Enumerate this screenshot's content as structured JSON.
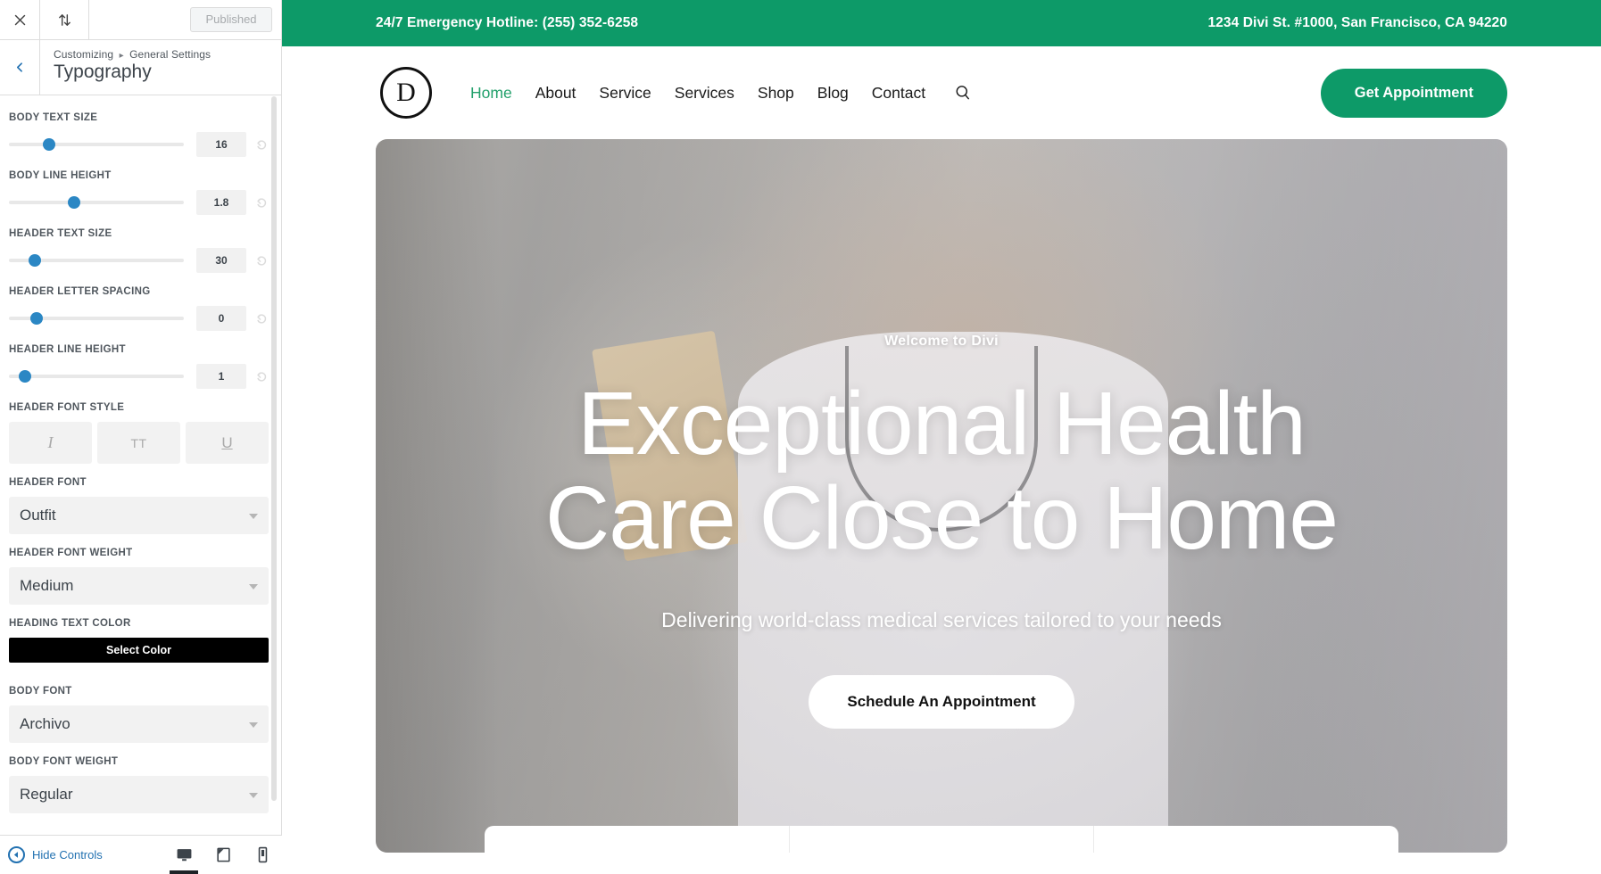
{
  "customizer": {
    "topbar": {
      "close_label": "Close customizer",
      "devices_label": "Collapse / expand",
      "publish_label": "Published"
    },
    "breadcrumb_root": "Customizing",
    "breadcrumb_separator": "▸",
    "breadcrumb_section": "General Settings",
    "panel_title": "Typography",
    "sliders": [
      {
        "label": "BODY TEXT SIZE",
        "value": "16",
        "pct": 23
      },
      {
        "label": "BODY LINE HEIGHT",
        "value": "1.8",
        "pct": 37
      },
      {
        "label": "HEADER TEXT SIZE",
        "value": "30",
        "pct": 15
      },
      {
        "label": "HEADER LETTER SPACING",
        "value": "0",
        "pct": 16
      },
      {
        "label": "HEADER LINE HEIGHT",
        "value": "1",
        "pct": 9
      }
    ],
    "font_style": {
      "label": "HEADER FONT STYLE",
      "buttons": [
        {
          "name": "italic",
          "glyph": "I"
        },
        {
          "name": "uppercase",
          "glyph": "TT"
        },
        {
          "name": "underline",
          "glyph": "U"
        }
      ]
    },
    "header_font": {
      "label": "HEADER FONT",
      "value": "Outfit"
    },
    "header_font_weight": {
      "label": "HEADER FONT WEIGHT",
      "value": "Medium"
    },
    "heading_text_color": {
      "label": "HEADING TEXT COLOR",
      "button": "Select Color",
      "swatch": "#000000"
    },
    "body_font": {
      "label": "BODY FONT",
      "value": "Archivo"
    },
    "body_font_weight": {
      "label": "BODY FONT WEIGHT",
      "value": "Regular"
    },
    "footer": {
      "hide_controls": "Hide Controls",
      "devices": [
        {
          "name": "desktop",
          "active": true
        },
        {
          "name": "tablet",
          "active": false
        },
        {
          "name": "mobile",
          "active": false
        }
      ]
    }
  },
  "site": {
    "topbar": {
      "hotline": "24/7 Emergency Hotline: (255) 352-6258",
      "address": "1234 Divi St. #1000, San Francisco, CA 94220",
      "background": "#0d9a68"
    },
    "nav": {
      "logo_letter": "D",
      "links": [
        {
          "label": "Home",
          "active": true
        },
        {
          "label": "About",
          "active": false
        },
        {
          "label": "Service",
          "active": false
        },
        {
          "label": "Services",
          "active": false
        },
        {
          "label": "Shop",
          "active": false
        },
        {
          "label": "Blog",
          "active": false
        },
        {
          "label": "Contact",
          "active": false
        }
      ],
      "cta_label": "Get Appointment",
      "accent": "#0d9a68",
      "active_color": "#22a06b"
    },
    "hero": {
      "eyebrow": "Welcome to Divi",
      "heading_line1": "Exceptional Health",
      "heading_line2": "Care Close to Home",
      "subheading": "Delivering world-class medical services tailored to your needs",
      "button_label": "Schedule An Appointment"
    }
  }
}
